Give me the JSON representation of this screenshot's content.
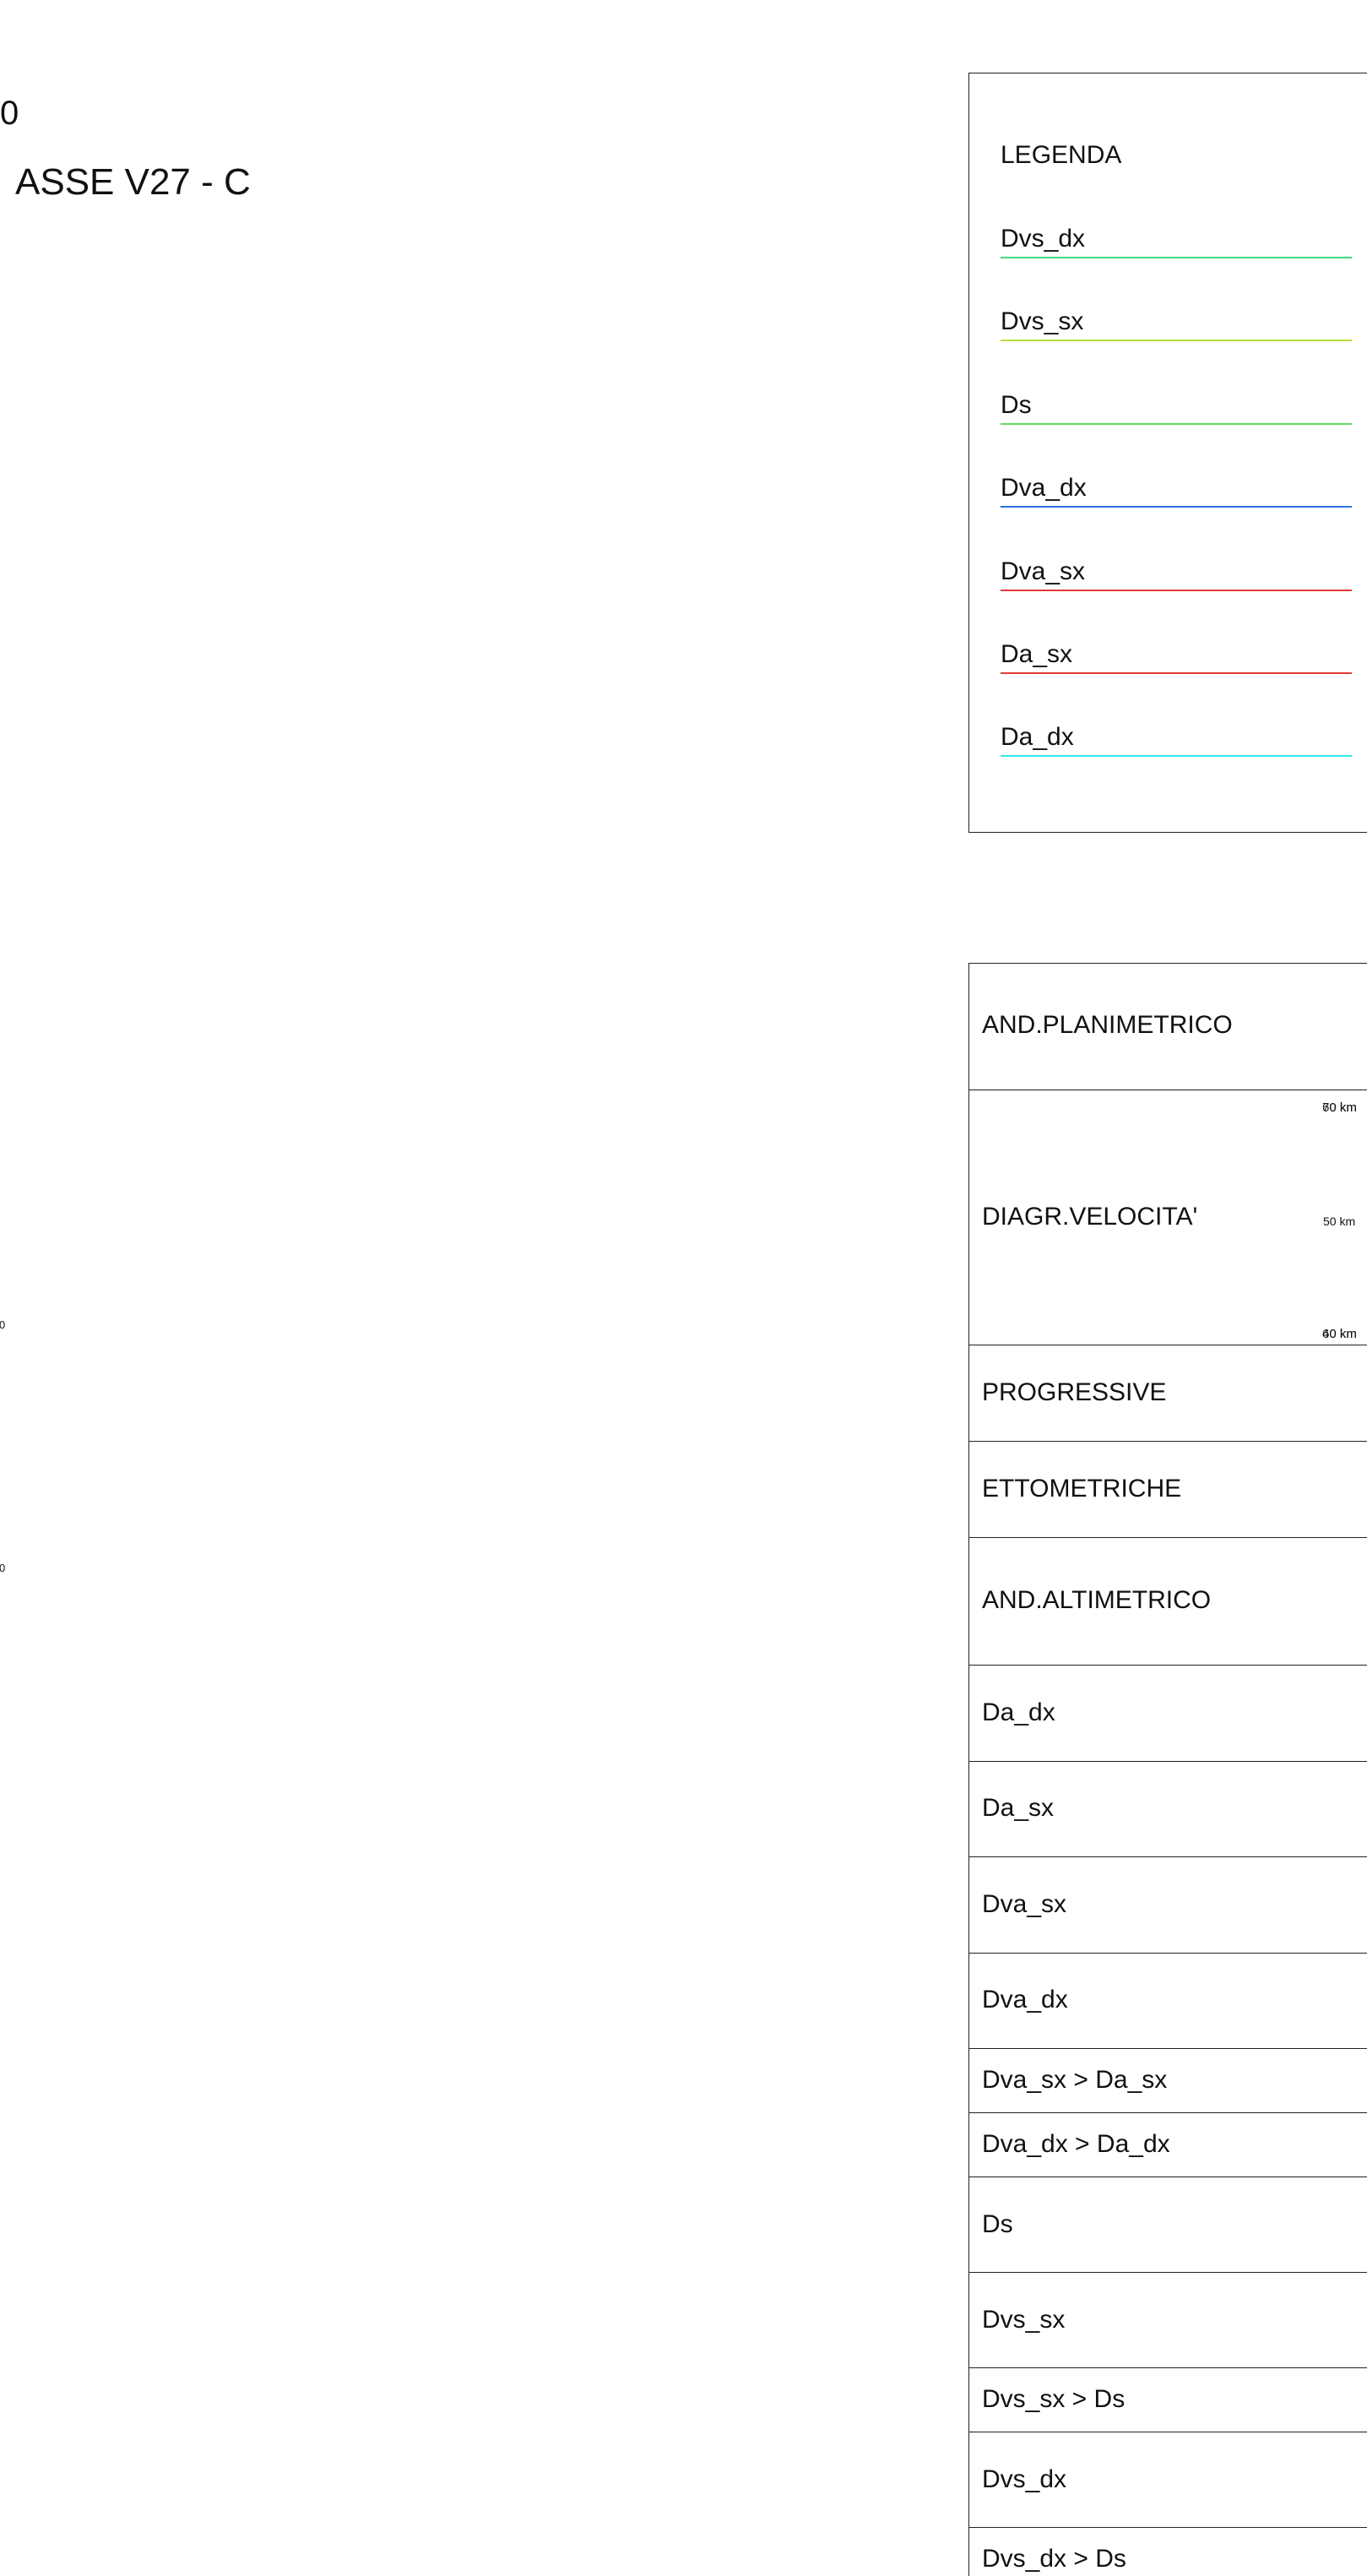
{
  "header": {
    "top_left": "0",
    "title": "ASSE V27 - C",
    "side_marks": [
      "0",
      "0"
    ]
  },
  "legend": {
    "title": "LEGENDA",
    "items": [
      {
        "label": "Dvs_dx",
        "color": "#3ddc84"
      },
      {
        "label": "Dvs_sx",
        "color": "#b6e03a"
      },
      {
        "label": "Ds",
        "color": "#5fe05f"
      },
      {
        "label": "Dva_dx",
        "color": "#2f6fe0"
      },
      {
        "label": "Dva_sx",
        "color": "#e53935"
      },
      {
        "label": "Da_sx",
        "color": "#e53935"
      },
      {
        "label": "Da_dx",
        "color": "#2ee6e6"
      }
    ]
  },
  "profile": {
    "rows": [
      {
        "label": "AND.PLANIMETRICO"
      },
      {
        "label": "DIAGR.VELOCITA'"
      },
      {
        "label": "PROGRESSIVE"
      },
      {
        "label": "ETTOMETRICHE"
      },
      {
        "label": "AND.ALTIMETRICO"
      },
      {
        "label": "Da_dx"
      },
      {
        "label": "Da_sx"
      },
      {
        "label": "Dva_sx"
      },
      {
        "label": "Dva_dx"
      },
      {
        "label": "Dva_sx > Da_sx"
      },
      {
        "label": "Dva_dx > Da_dx"
      },
      {
        "label": "Ds"
      },
      {
        "label": "Dvs_sx"
      },
      {
        "label": "Dvs_sx > Ds"
      },
      {
        "label": "Dvs_dx"
      },
      {
        "label": "Dvs_dx > Ds"
      }
    ],
    "speed_scale": {
      "top_a": "70 km",
      "top_b": "60 km",
      "mid": "50 km",
      "bottom_a": "40 km",
      "bottom_b": "60 km"
    }
  }
}
